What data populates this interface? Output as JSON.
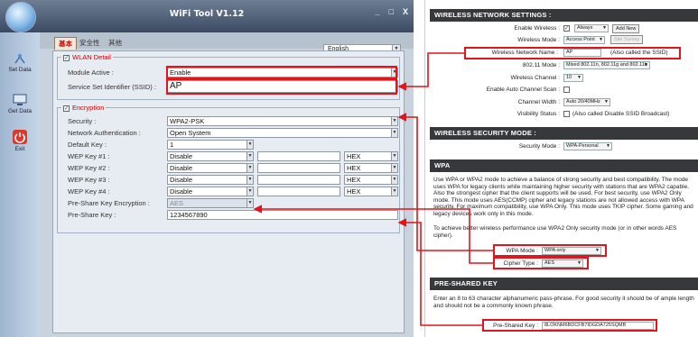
{
  "app": {
    "title": "WiFi Tool V1.12",
    "window_buttons": [
      "_",
      "□",
      "X"
    ],
    "sidebar": [
      {
        "label": "Set Data",
        "icon": "wifi-icon"
      },
      {
        "label": "Get Data",
        "icon": "computer-icon"
      },
      {
        "label": "Exit",
        "icon": "power-icon"
      }
    ],
    "tabs": [
      "基本",
      "安全性",
      "其他"
    ],
    "language": "English",
    "wlan": {
      "legend": "WLAN Detail",
      "module_active_label": "Module Active :",
      "module_active_value": "Enable",
      "ssid_label": "Service Set Identifier (SSID) :",
      "ssid_value": "AP"
    },
    "encryption": {
      "legend": "Encryption",
      "rows": [
        {
          "label": "Security :",
          "value": "WPA2-PSK"
        },
        {
          "label": "Network Authentication :",
          "value": "Open System"
        },
        {
          "label": "Default Key :",
          "value": "1"
        },
        {
          "label": "WEP Key #1 :",
          "value": "Disable",
          "format": "HEX"
        },
        {
          "label": "WEP Key #2 :",
          "value": "Disable",
          "format": "HEX"
        },
        {
          "label": "WEP Key #3 :",
          "value": "Disable",
          "format": "HEX"
        },
        {
          "label": "WEP Key #4 :",
          "value": "Disable",
          "format": "HEX"
        },
        {
          "label": "Pre-Share Key Encryption :",
          "value": "AES"
        },
        {
          "label": "Pre-Share Key :",
          "value": "1234567890"
        }
      ]
    }
  },
  "router": {
    "wireless_settings": {
      "heading": "WIRELESS NETWORK SETTINGS :",
      "enable_wireless_label": "Enable Wireless :",
      "enable_wireless_schedule": "Always",
      "add_new_button": "Add New",
      "wireless_mode_label": "Wireless Mode :",
      "wireless_mode_value": "Access Point",
      "site_survey_button": "Site Survey",
      "network_name_label": "Wireless Network Name :",
      "network_name_value": "AP",
      "network_name_note": "(Also called the SSID)",
      "mode_80211_label": "802.11 Mode :",
      "mode_80211_value": "Mixed 802.11n, 802.11g and 802.11b",
      "channel_label": "Wireless Channel :",
      "channel_value": "10",
      "auto_scan_label": "Enable Auto Channel Scan :",
      "channel_width_label": "Channel Width :",
      "channel_width_value": "Auto 20/40MHz",
      "visibility_label": "Visibility Status :",
      "visibility_note": "(Also called Disable SSID Broadcast)"
    },
    "security_mode": {
      "heading": "WIRELESS SECURITY MODE :",
      "label": "Security Mode :",
      "value": "WPA-Personal"
    },
    "wpa": {
      "heading": "WPA",
      "para1": "Use WPA or WPA2 mode to achieve a balance of strong security and best compatibility. The mode uses WPA for legacy clients while maintaining higher security with stations that are WPA2 capable. Also the strongest cipher that the client supports will be used. For best security, use WPA2 Only mode. This mode uses AES(CCMP) cipher and legacy stations are not allowed access with WPA security. For maximum compatibility, use WPA Only. This mode uses TKIP cipher. Some gaming and legacy devices work only in this mode.",
      "para2": "To achieve better wireless performance use WPA2 Only security mode (or in other words AES cipher).",
      "mode_label": "WPA Mode :",
      "mode_value": "WPA only",
      "cipher_label": "Cipher Type :",
      "cipher_value": "AES"
    },
    "psk": {
      "heading": "PRE-SHARED KEY",
      "para": "Enter an 8 to 63 character alphanumeric pass-phrase. For good security it should be of ample length and should not be a commonly known phrase.",
      "label": "Pre-Shared Key :",
      "value": "8LOKNM6BDCFB7IDGDA725SQMB"
    }
  },
  "colors": {
    "highlight": "#e2141c",
    "section_header": "#36383b",
    "sidebar": "#b0c4da",
    "tab_active": "#c00000"
  }
}
